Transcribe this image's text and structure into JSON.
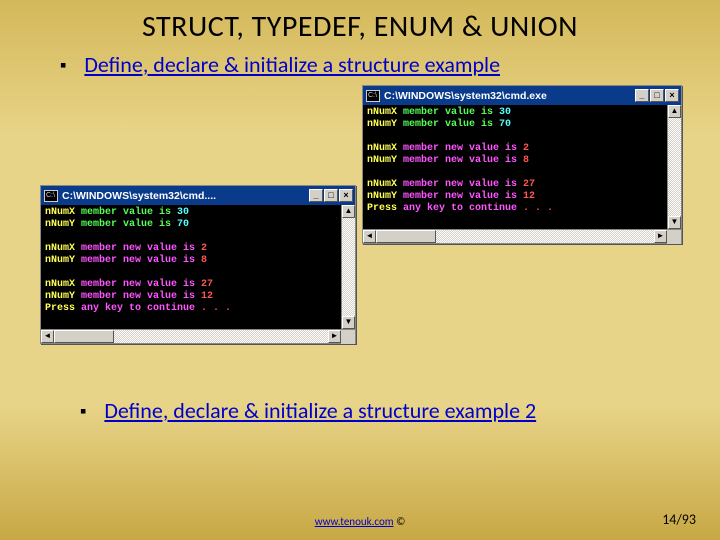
{
  "title": "STRUCT, TYPEDEF, ENUM & UNION",
  "links": {
    "example1": "Define, declare & initialize a structure example",
    "example2": "Define, declare & initialize a structure example 2"
  },
  "windows": {
    "right": {
      "title": "C:\\WINDOWS\\system32\\cmd.exe",
      "icon_label": "C:\\"
    },
    "left": {
      "title": "C:\\WINDOWS\\system32\\cmd....",
      "icon_label": "C:\\"
    }
  },
  "titlebar_buttons": {
    "minimize": "_",
    "maximize": "□",
    "close": "×"
  },
  "scroll_arrows": {
    "up": "▲",
    "down": "▼",
    "left": "◄",
    "right": "►"
  },
  "console": {
    "l1a": "nNumX",
    "l1b": " member value is ",
    "l1c": "30",
    "l2a": "nNumY",
    "l2b": " member value is ",
    "l2c": "70",
    "l3a": "nNumX",
    "l3b": " member new value is ",
    "l3c": "2",
    "l4a": "nNumY",
    "l4b": " member new value is ",
    "l4c": "8",
    "l5a": "nNumX",
    "l5b": " member new value is ",
    "l5c": "27",
    "l6a": "nNumY",
    "l6b": " member new value is ",
    "l6c": "12",
    "l7a": "Press",
    "l7b": " any key to continue ",
    "l7c": ". . ."
  },
  "footer": {
    "url": "www.tenouk.com",
    "copyright": " ©"
  },
  "pagenum": "14/93"
}
